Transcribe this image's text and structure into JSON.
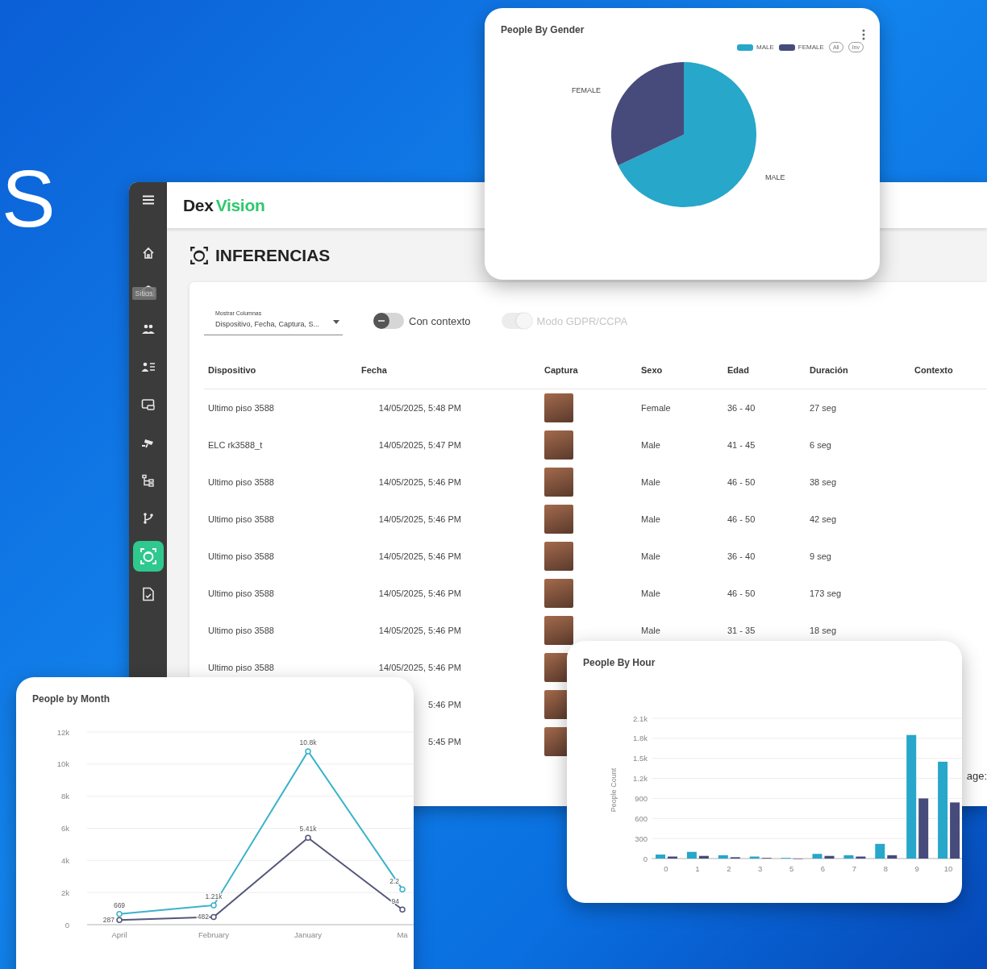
{
  "hero_text": "S",
  "sidebar": {
    "tooltip": "Sitios",
    "items": [
      {
        "kind": "home",
        "selected": false
      },
      {
        "kind": "sites",
        "selected": false
      },
      {
        "kind": "people",
        "selected": false
      },
      {
        "kind": "users",
        "selected": false
      },
      {
        "kind": "devices",
        "selected": false
      },
      {
        "kind": "cameras",
        "selected": false
      },
      {
        "kind": "hierarchy",
        "selected": false
      },
      {
        "kind": "branch",
        "selected": false
      },
      {
        "kind": "inferences",
        "selected": true
      },
      {
        "kind": "reports",
        "selected": false
      }
    ]
  },
  "header": {
    "logo_part_1": "Dex",
    "logo_part_2": "Vision"
  },
  "page_title": "INFERENCIAS",
  "filters": {
    "columns_select": {
      "label": "Mostrar Columnas",
      "value": "Dispositivo, Fecha, Captura, S..."
    },
    "toggles": [
      {
        "label": "Con contexto",
        "on": false,
        "disabled": false
      },
      {
        "label": "Modo GDPR/CCPA",
        "on": true,
        "disabled": true
      }
    ]
  },
  "table": {
    "columns": [
      "Dispositivo",
      "Fecha",
      "Captura",
      "Sexo",
      "Edad",
      "Duración",
      "Contexto"
    ],
    "rows": [
      {
        "device": "Ultimo piso 3588",
        "date": "14/05/2025, 5:48 PM",
        "photo": true,
        "sex": "Female",
        "age": "36 - 40",
        "duration": "27 seg"
      },
      {
        "device": "ELC rk3588_t",
        "date": "14/05/2025, 5:47 PM",
        "photo": true,
        "sex": "Male",
        "age": "41 - 45",
        "duration": "6 seg"
      },
      {
        "device": "Ultimo piso 3588",
        "date": "14/05/2025, 5:46 PM",
        "photo": true,
        "sex": "Male",
        "age": "46 - 50",
        "duration": "38 seg"
      },
      {
        "device": "Ultimo piso 3588",
        "date": "14/05/2025, 5:46 PM",
        "photo": true,
        "sex": "Male",
        "age": "46 - 50",
        "duration": "42 seg"
      },
      {
        "device": "Ultimo piso 3588",
        "date": "14/05/2025, 5:46 PM",
        "photo": true,
        "sex": "Male",
        "age": "36 - 40",
        "duration": "9 seg"
      },
      {
        "device": "Ultimo piso 3588",
        "date": "14/05/2025, 5:46 PM",
        "photo": true,
        "sex": "Male",
        "age": "46 - 50",
        "duration": "173 seg"
      },
      {
        "device": "Ultimo piso 3588",
        "date": "14/05/2025, 5:46 PM",
        "photo": true,
        "sex": "Male",
        "age": "31 - 35",
        "duration": "18 seg"
      },
      {
        "device": "Ultimo piso 3588",
        "date": "14/05/2025, 5:46 PM",
        "photo": true
      },
      {
        "date": "5:46 PM",
        "photo": true
      },
      {
        "date": "5:45 PM",
        "photo": true
      }
    ]
  },
  "pagination_fragment": "age:",
  "gender_card": {
    "title": "People By Gender",
    "legend": [
      {
        "label": "MALE",
        "color": "#27a7c9"
      },
      {
        "label": "FEMALE",
        "color": "#464b7c"
      }
    ],
    "legend_buttons": [
      "All",
      "Inv"
    ],
    "slice_labels": [
      "FEMALE",
      "MALE"
    ]
  },
  "month_card": {
    "title": "People by Month",
    "chart_data": {
      "type": "line",
      "categories": [
        "April",
        "February",
        "January",
        "Ma"
      ],
      "ylim": [
        0,
        12000
      ],
      "yticks": [
        {
          "value": 0,
          "label": "0"
        },
        {
          "value": 2000,
          "label": "2k"
        },
        {
          "value": 4000,
          "label": "4k"
        },
        {
          "value": 6000,
          "label": "6k"
        },
        {
          "value": 8000,
          "label": "8k"
        },
        {
          "value": 10000,
          "label": "10k"
        },
        {
          "value": 12000,
          "label": "12k"
        }
      ],
      "series": [
        {
          "color": "#3bb3c9",
          "marker": "circle",
          "values": [
            669,
            1210,
            10800,
            2200
          ],
          "value_labels": [
            "669",
            "1.21k",
            "10.8k",
            null
          ]
        },
        {
          "color": "#54577a",
          "marker": "circle",
          "values": [
            287,
            482,
            5410,
            940
          ],
          "value_labels": [
            "287",
            "482",
            "5.41k",
            null
          ]
        }
      ],
      "grid": true,
      "annotations": [
        {
          "text": "2.2",
          "x": "Ma",
          "y": 2200
        },
        {
          "text": "94",
          "x": "Ma",
          "y": 940
        }
      ]
    }
  },
  "hour_card": {
    "title": "People By Hour",
    "chart_data": {
      "type": "bar",
      "ylabel": "People Count",
      "categories": [
        "0",
        "1",
        "2",
        "3",
        "5",
        "6",
        "7",
        "8",
        "9",
        "10"
      ],
      "ylim": [
        0,
        2100
      ],
      "yticks": [
        {
          "value": 0,
          "label": "0"
        },
        {
          "value": 300,
          "label": "300"
        },
        {
          "value": 600,
          "label": "600"
        },
        {
          "value": 900,
          "label": "900"
        },
        {
          "value": 1200,
          "label": "1.2k"
        },
        {
          "value": 1500,
          "label": "1.5k"
        },
        {
          "value": 1800,
          "label": "1.8k"
        },
        {
          "value": 2100,
          "label": "2.1k"
        }
      ],
      "series": [
        {
          "color": "#27a7c9",
          "values": [
            60,
            100,
            50,
            30,
            10,
            70,
            50,
            220,
            1850,
            1450
          ]
        },
        {
          "color": "#464b7c",
          "values": [
            30,
            40,
            20,
            10,
            0,
            40,
            30,
            50,
            900,
            840
          ]
        }
      ],
      "grid": true
    }
  }
}
